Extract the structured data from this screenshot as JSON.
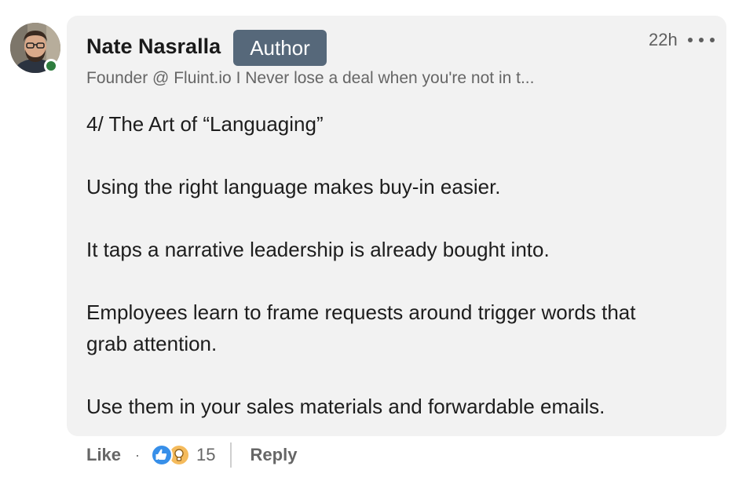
{
  "comment": {
    "author_name": "Nate Nasralla",
    "author_badge": "Author",
    "timestamp": "22h",
    "headline": "Founder @ Fluint.io I Never lose a deal when you're not in t...",
    "presence": "online",
    "body_paragraphs": [
      "4/ The Art of “Languaging”",
      "Using the right language makes buy-in easier.",
      "It taps a narrative leadership is already bought into.",
      "Employees learn to frame requests around trigger words that grab attention.",
      "Use them in your sales materials and forwardable emails."
    ]
  },
  "actions": {
    "like_label": "Like",
    "separator": "·",
    "reaction_icons": [
      "like-reaction-icon",
      "insightful-reaction-icon"
    ],
    "reaction_count": "15",
    "reply_label": "Reply"
  },
  "colors": {
    "bubble_bg": "#f2f2f2",
    "badge_bg": "#56687a",
    "presence_green": "#2e7d3e",
    "like_blue": "#378fe9",
    "insight_yellow": "#f5bb5c"
  }
}
